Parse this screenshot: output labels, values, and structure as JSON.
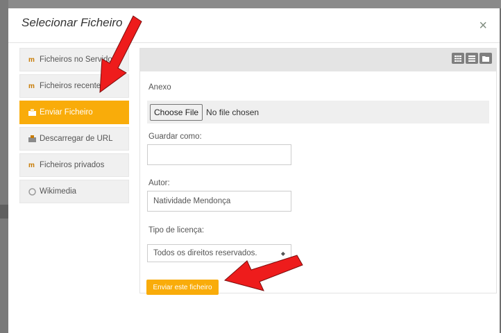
{
  "dialog": {
    "title": "Selecionar Ficheiro",
    "close_glyph": "×"
  },
  "sidebar": {
    "items": [
      {
        "label": "Ficheiros no Servidor",
        "icon": "moodle-icon",
        "active": false
      },
      {
        "label": "Ficheiros recentes",
        "icon": "moodle-icon",
        "active": false
      },
      {
        "label": "Enviar Ficheiro",
        "icon": "upload-icon",
        "active": true
      },
      {
        "label": "Descarregar de URL",
        "icon": "download-url-icon",
        "active": false
      },
      {
        "label": "Ficheiros privados",
        "icon": "moodle-icon",
        "active": false
      },
      {
        "label": "Wikimedia",
        "icon": "wikimedia-icon",
        "active": false
      }
    ]
  },
  "toolbar": {
    "view_icons": [
      "grid-view-icon",
      "list-view-icon",
      "folder-view-icon"
    ]
  },
  "form": {
    "attachment_label": "Anexo",
    "choose_file_label": "Choose File",
    "file_status": "No file chosen",
    "save_as_label": "Guardar como:",
    "save_as_value": "",
    "author_label": "Autor:",
    "author_value": "Natividade Mendonça",
    "license_label": "Tipo de licença:",
    "license_value": "Todos os direitos reservados.",
    "submit_label": "Enviar este ficheiro"
  },
  "colors": {
    "accent": "#f9ac0a",
    "arrow": "#ee1c1c"
  }
}
